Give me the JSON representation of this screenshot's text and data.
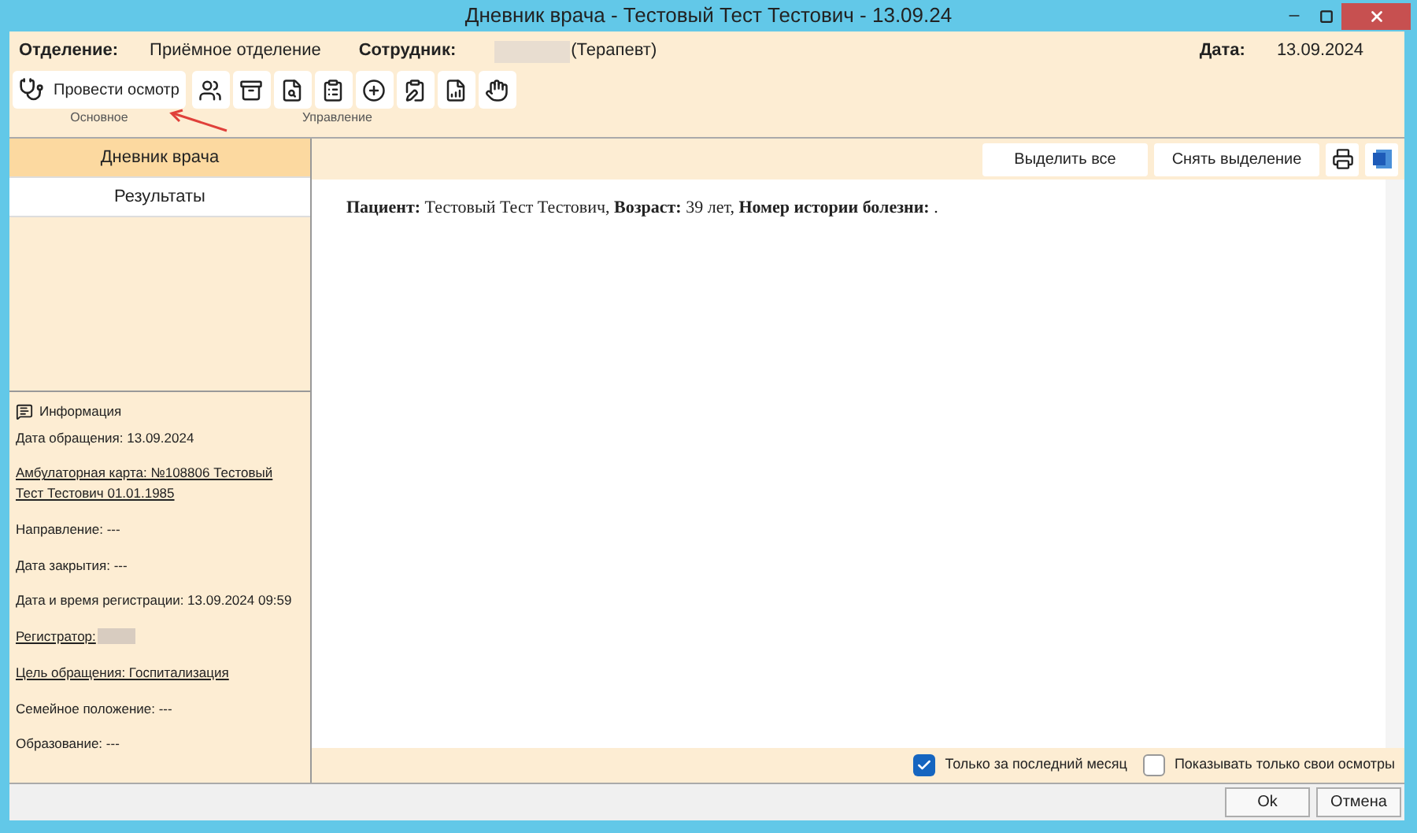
{
  "window": {
    "title": "Дневник врача - Тестовый Тест Тестович - 13.09.24"
  },
  "header": {
    "department_label": "Отделение:",
    "department": "Приёмное отделение",
    "employee_label": "Сотрудник:",
    "employee_role": "(Терапевт)",
    "date_label": "Дата:",
    "date": "13.09.2024"
  },
  "toolbar": {
    "primary_button": "Провести осмотр",
    "group_main": "Основное",
    "group_manage": "Управление"
  },
  "sidebar": {
    "items": [
      {
        "label": "Дневник врача",
        "selected": true
      },
      {
        "label": "Результаты",
        "selected": false
      }
    ]
  },
  "info": {
    "title": "Информация",
    "lines": [
      {
        "kind": "text",
        "text": "Дата обращения: 13.09.2024"
      },
      {
        "kind": "link",
        "text": "Амбулаторная карта: №108806 Тестовый Тест Тестович 01.01.1985"
      },
      {
        "kind": "text",
        "text": "Направление: ---"
      },
      {
        "kind": "text",
        "text": "Дата закрытия: ---"
      },
      {
        "kind": "text",
        "text": "Дата и время регистрации: 13.09.2024 09:59"
      },
      {
        "kind": "redacted-link",
        "text": "Регистратор:"
      },
      {
        "kind": "link",
        "text": "Цель обращения: Госпитализация"
      },
      {
        "kind": "text",
        "text": "Семейное положение: ---"
      },
      {
        "kind": "text",
        "text": "Образование: ---"
      }
    ]
  },
  "content": {
    "select_all": "Выделить все",
    "deselect": "Снять выделение",
    "text": "**Пациент:** Тестовый Тест Тестович, **Возраст:** 39 лет, **Номер истории болезни:** ."
  },
  "filters": [
    {
      "label": "Только за последний месяц",
      "checked": true
    },
    {
      "label": "Показывать только свои осмотры",
      "checked": false
    }
  ],
  "buttons": [
    "Ok",
    "Отмена"
  ]
}
